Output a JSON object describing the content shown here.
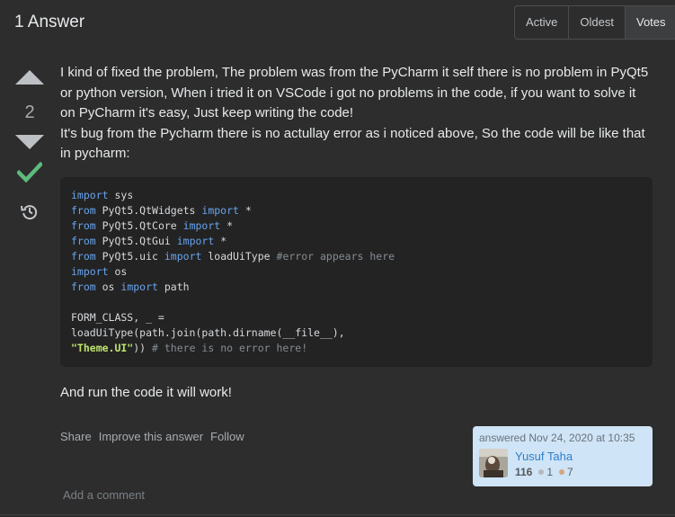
{
  "header": {
    "answer_count": "1 Answer",
    "sort_options": [
      "Active",
      "Oldest",
      "Votes"
    ],
    "selected_sort": "Votes"
  },
  "voting": {
    "score": "2",
    "accepted": true
  },
  "post": {
    "paragraph_1": "I kind of fixed the problem, The problem was from the PyCharm it self there is no problem in PyQt5 or python version, When i tried it on VSCode i got no problems in the code, if you want to solve it on PyCharm it's easy, Just keep writing the code!",
    "paragraph_2": "It's bug from the Pycharm there is no actullay error as i noticed above, So the code will be like that in pycharm:",
    "code_lines": [
      [
        {
          "t": "import",
          "c": "kw"
        },
        {
          "t": " sys"
        }
      ],
      [
        {
          "t": "from",
          "c": "kw"
        },
        {
          "t": " PyQt5.QtWidgets "
        },
        {
          "t": "import",
          "c": "kw"
        },
        {
          "t": " *"
        }
      ],
      [
        {
          "t": "from",
          "c": "kw"
        },
        {
          "t": " PyQt5.QtCore "
        },
        {
          "t": "import",
          "c": "kw"
        },
        {
          "t": " *"
        }
      ],
      [
        {
          "t": "from",
          "c": "kw"
        },
        {
          "t": " PyQt5.QtGui "
        },
        {
          "t": "import",
          "c": "kw"
        },
        {
          "t": " *"
        }
      ],
      [
        {
          "t": "from",
          "c": "kw"
        },
        {
          "t": " PyQt5.uic "
        },
        {
          "t": "import",
          "c": "kw"
        },
        {
          "t": " loadUiType "
        },
        {
          "t": "#error appears here",
          "c": "cm"
        }
      ],
      [
        {
          "t": "import",
          "c": "kw"
        },
        {
          "t": " os"
        }
      ],
      [
        {
          "t": "from",
          "c": "kw"
        },
        {
          "t": " os "
        },
        {
          "t": "import",
          "c": "kw"
        },
        {
          "t": " path"
        }
      ],
      [],
      [
        {
          "t": "FORM_CLASS, _ ="
        }
      ],
      [
        {
          "t": "loadUiType(path.join(path.dirname(__file__),"
        }
      ],
      [
        {
          "t": "\"Theme.UI\"",
          "c": "st"
        },
        {
          "t": ")) "
        },
        {
          "t": "# there is no error here!",
          "c": "cm"
        }
      ]
    ],
    "closing": "And run the code it will work!"
  },
  "post_menu": {
    "share": "Share",
    "improve": "Improve this answer",
    "follow": "Follow"
  },
  "user_card": {
    "action": "answered Nov 24, 2020 at 10:35",
    "name": "Yusuf Taha",
    "reputation": "116",
    "silver_badges": "1",
    "bronze_badges": "7"
  },
  "comments": {
    "add_comment": "Add a comment"
  },
  "colors": {
    "background": "#2d2d2d",
    "accepted": "#5eba7d",
    "link": "#2f7fca",
    "user_card_bg": "#cfe4f6",
    "code_bg": "#232323"
  },
  "icons": [
    "arrow-up-icon",
    "arrow-down-icon",
    "check-icon",
    "history-icon"
  ]
}
